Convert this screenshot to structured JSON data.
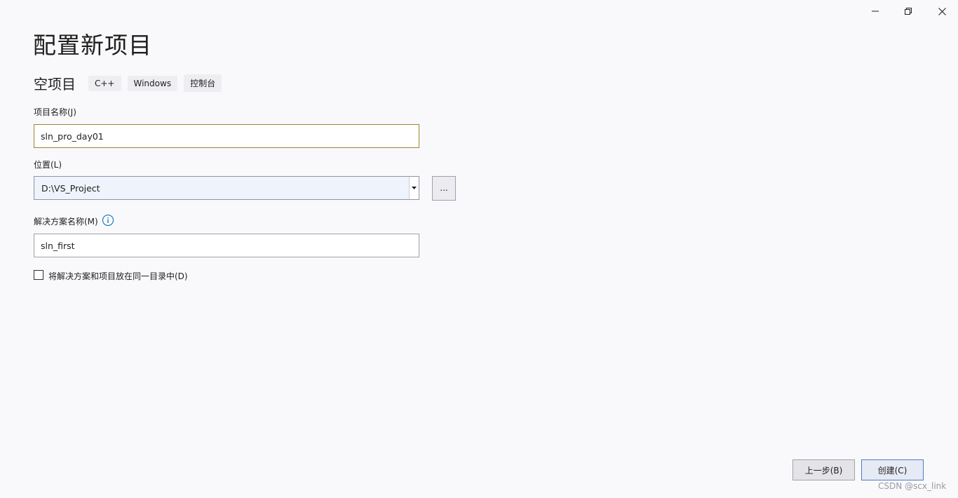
{
  "window": {
    "minimize_icon": "minimize-icon",
    "restore_icon": "restore-icon",
    "close_icon": "close-icon"
  },
  "page": {
    "title": "配置新项目",
    "template_name": "空项目",
    "tags": [
      "C++",
      "Windows",
      "控制台"
    ]
  },
  "form": {
    "project_name_label": "项目名称(J)",
    "project_name_value": "sln_pro_day01",
    "location_label": "位置(L)",
    "location_value": "D:\\VS_Project",
    "browse_label": "...",
    "solution_name_label": "解决方案名称(M)",
    "solution_name_value": "sln_first",
    "same_dir_checkbox_label": "将解决方案和项目放在同一目录中(D)",
    "same_dir_checked": false
  },
  "footer": {
    "back_label": "上一步(B)",
    "create_label": "创建(C)",
    "watermark": "CSDN @scx_link"
  },
  "colors": {
    "background": "#f9f9fb",
    "accent_blue": "#4f7dc0",
    "focus_border": "#a08236",
    "info_icon": "#1e7fc2"
  }
}
